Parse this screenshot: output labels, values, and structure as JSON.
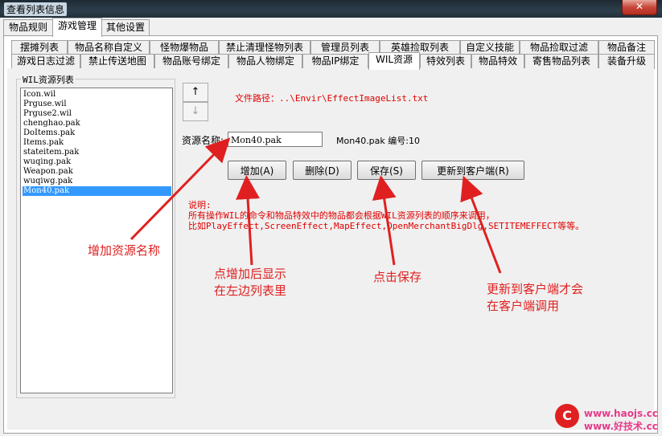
{
  "window": {
    "title": "查看列表信息",
    "close_label": "✕"
  },
  "top_tabs": [
    "物品规则",
    "游戏管理",
    "其他设置"
  ],
  "sub_tabs_row1": [
    "摆摊列表",
    "物品名称自定义",
    "怪物爆物品",
    "禁止清理怪物列表",
    "管理员列表",
    "英雄捡取列表",
    "自定义技能",
    "物品捡取过滤",
    "物品备注"
  ],
  "sub_tabs_row2": [
    "游戏日志过滤",
    "禁止传送地图",
    "物品账号绑定",
    "物品人物绑定",
    "物品IP绑定",
    "WIL资源",
    "特效列表",
    "物品特效",
    "寄售物品列表",
    "装备升级"
  ],
  "active_sub_tab": "WIL资源",
  "group": {
    "title": "WIL资源列表"
  },
  "list_items": [
    "Icon.wil",
    "Prguse.wil",
    "Prguse2.wil",
    "chenghao.pak",
    "DoItems.pak",
    "Items.pak",
    "stateitem.pak",
    "wuqing.pak",
    "Weapon.pak",
    "wuqiwg.pak",
    "Mon40.pak"
  ],
  "selected_item": "Mon40.pak",
  "move_up_icon": "↑",
  "move_down_icon": "↓",
  "file_path_label": "文件路径：..\\Envir\\EffectImageList.txt",
  "resource_name_label": "资源名称:",
  "resource_name_value": "Mon40.pak",
  "resource_info": "Mon40.pak 编号:10",
  "buttons": {
    "add": "增加(A)",
    "delete": "删除(D)",
    "save": "保存(S)",
    "update": "更新到客户端(R)"
  },
  "desc_title": "说明:",
  "desc_line1": "所有操作WIL的命令和物品特效中的物品都会根据WIL资源列表的顺序来调用，",
  "desc_line2": "比如PlayEffect,ScreenEffect,MapEffect,OpenMerchantBigDlg,SETITEMEFFECT等等。",
  "annotations": {
    "add_name": "增加资源名称",
    "after_add_1": "点增加后显示",
    "after_add_2": "在左边列表里",
    "click_save": "点击保存",
    "update_1": "更新到客户端才会",
    "update_2": "在客户端调用"
  },
  "watermark": {
    "logo": "C",
    "site": "www.haojs.cc",
    "site2": "www.好技术.cc"
  },
  "colors": {
    "annotation_red": "#e02020",
    "selection_blue": "#3399ff",
    "watermark_pink": "#e43b8a"
  }
}
